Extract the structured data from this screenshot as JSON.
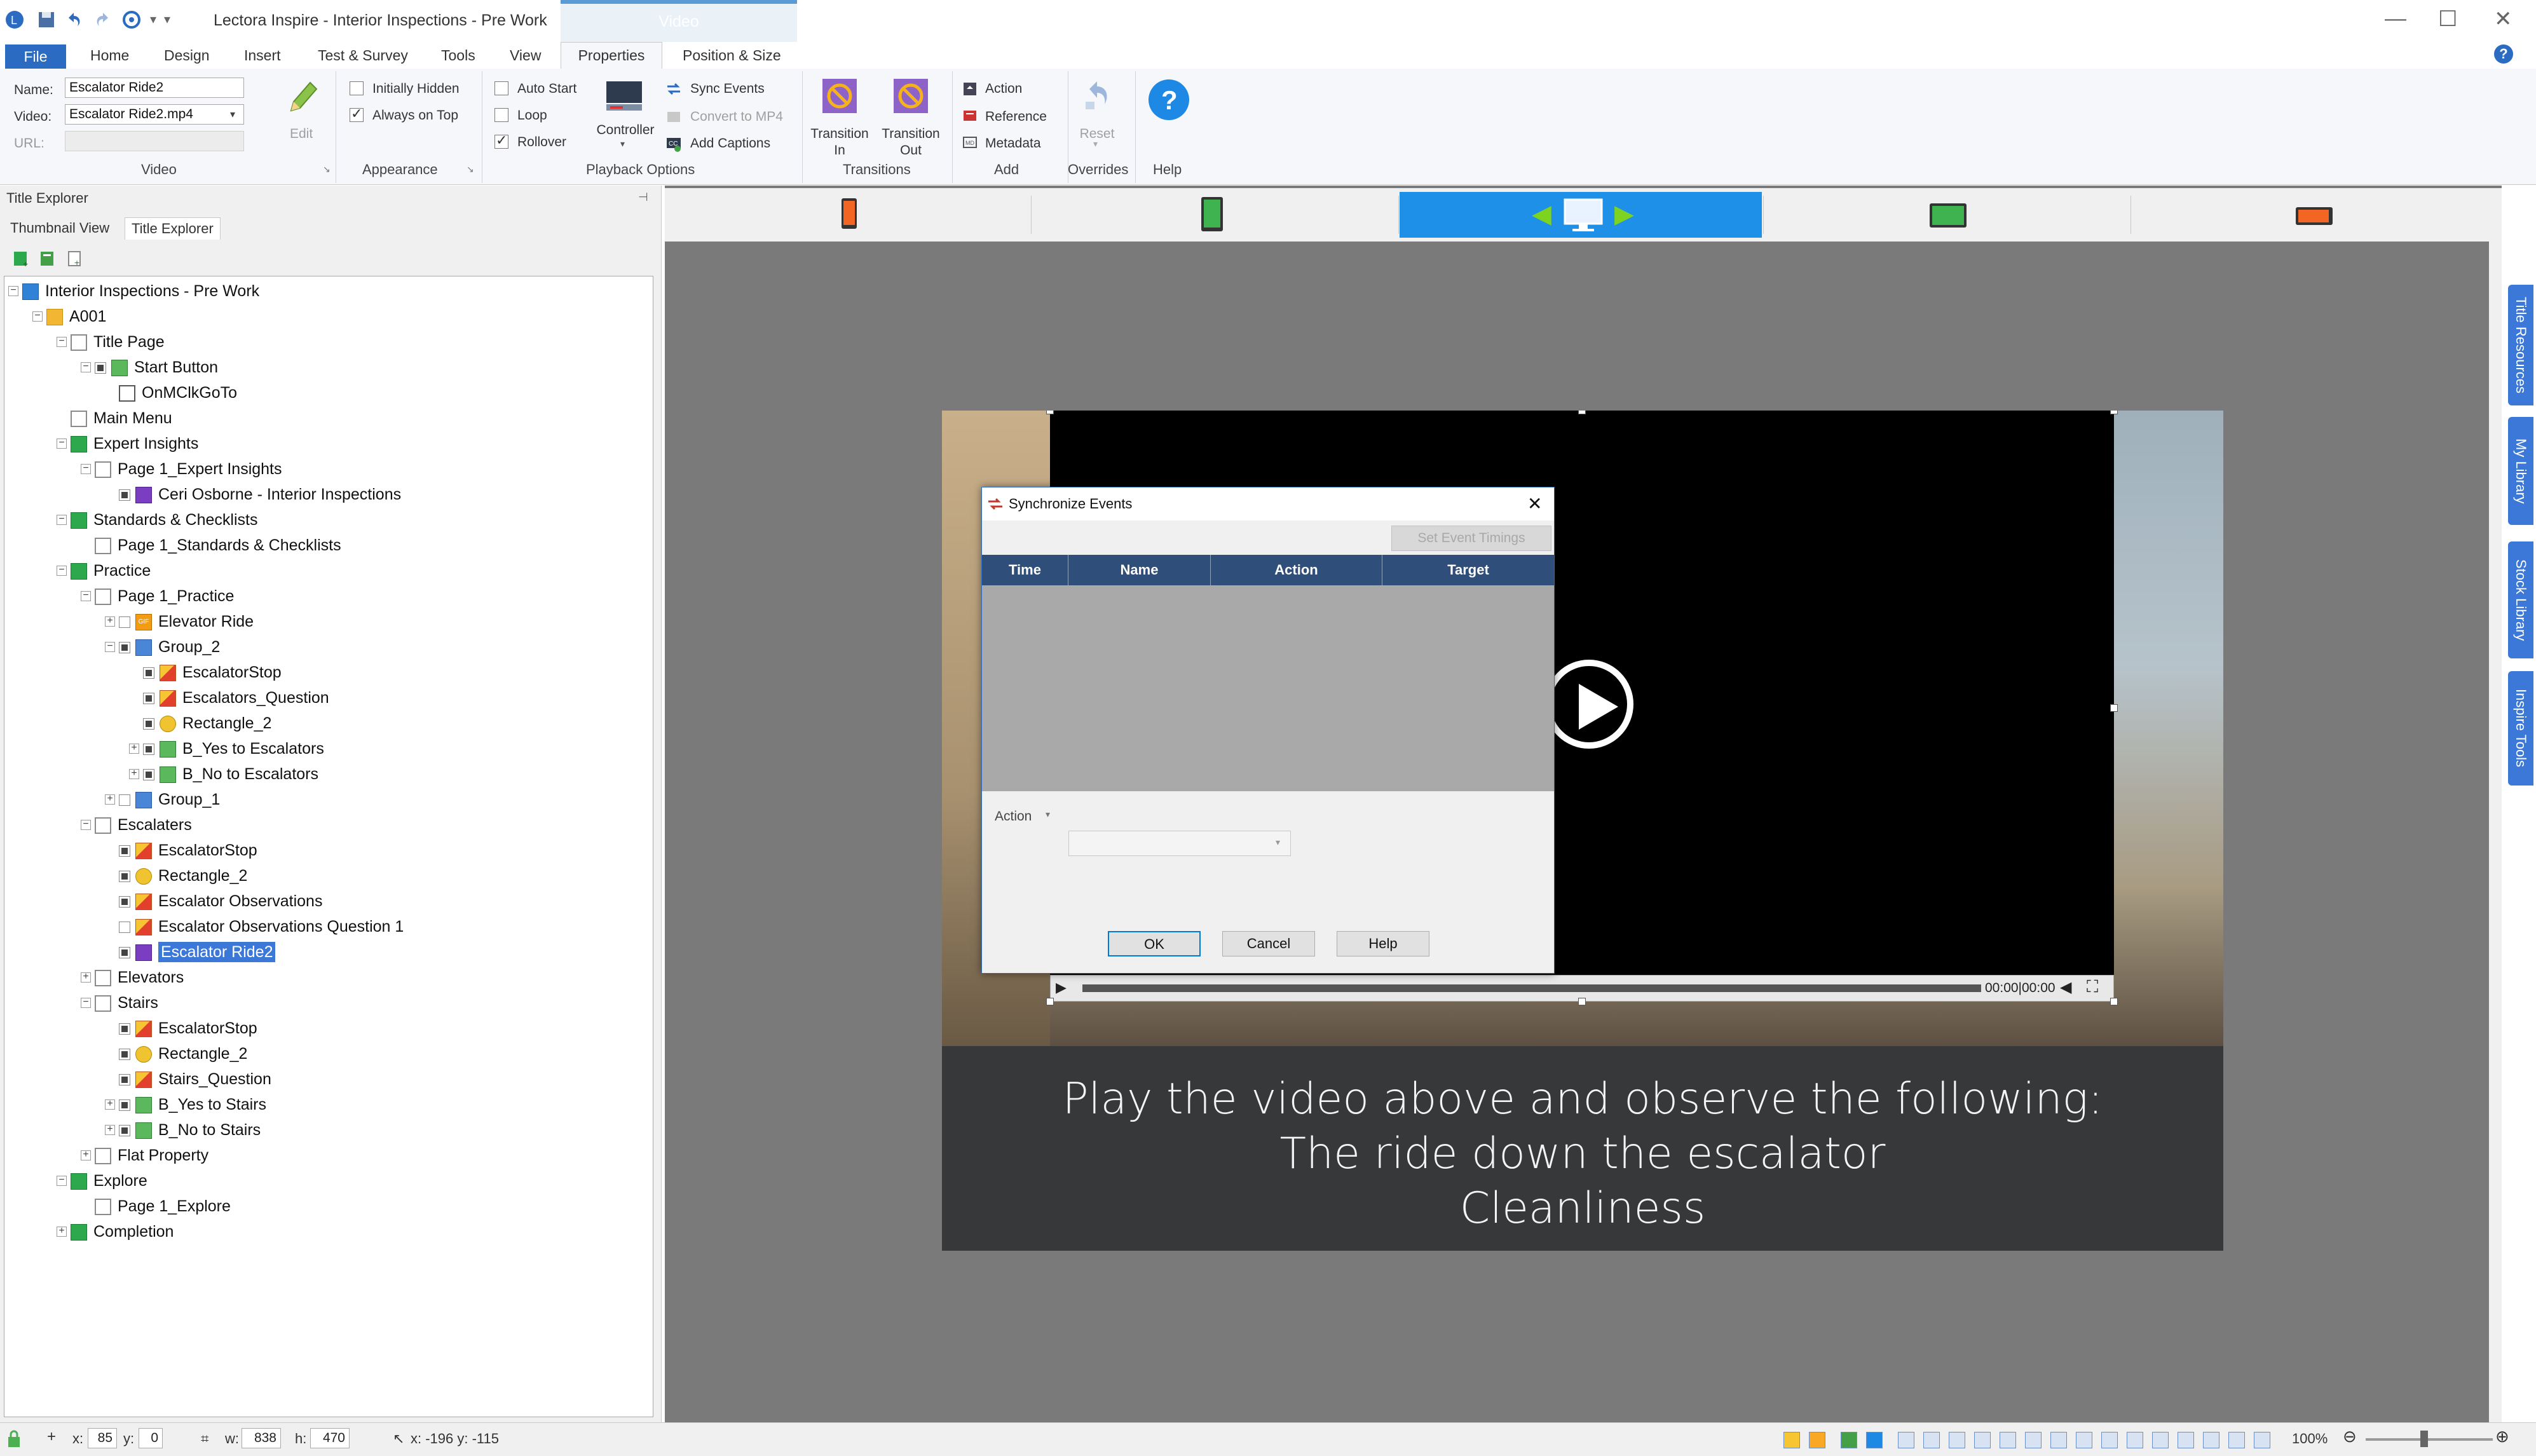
{
  "window": {
    "title": "Lectora Inspire - Interior Inspections - Pre Work",
    "context_tab_group": "Video"
  },
  "ribbon_tabs": [
    "File",
    "Home",
    "Design",
    "Insert",
    "Test & Survey",
    "Tools",
    "View",
    "Properties",
    "Position & Size"
  ],
  "ribbon": {
    "video_group": {
      "label": "Video",
      "name_label": "Name:",
      "name_value": "Escalator Ride2",
      "video_label": "Video:",
      "video_value": "Escalator Ride2.mp4",
      "url_label": "URL:"
    },
    "edit_label": "Edit",
    "appearance": {
      "label": "Appearance",
      "initially_hidden": "Initially Hidden",
      "always_on_top": "Always on Top"
    },
    "playback": {
      "label": "Playback Options",
      "auto_start": "Auto Start",
      "loop": "Loop",
      "rollover": "Rollover",
      "controller": "Controller",
      "sync_events": "Sync Events",
      "convert_mp4": "Convert to MP4",
      "add_captions": "Add Captions"
    },
    "transitions": {
      "label": "Transitions",
      "in_line1": "Transition",
      "in_line2": "In",
      "out_line1": "Transition",
      "out_line2": "Out"
    },
    "add": {
      "label": "Add",
      "action": "Action",
      "reference": "Reference",
      "metadata": "Metadata"
    },
    "overrides": {
      "label": "Overrides",
      "reset": "Reset"
    },
    "help": {
      "label": "Help"
    }
  },
  "left_panel": {
    "header": "Title Explorer",
    "tab_thumbnail": "Thumbnail View",
    "tab_title_explorer": "Title Explorer",
    "tree": [
      {
        "label": "Interior Inspections - Pre Work",
        "depth": 0,
        "icon": "title-icon",
        "expander": "-",
        "vis": "none"
      },
      {
        "label": "A001",
        "depth": 1,
        "icon": "folder-icon",
        "expander": "-",
        "vis": "none"
      },
      {
        "label": "Title Page",
        "depth": 2,
        "icon": "page-icon",
        "expander": "-",
        "vis": "none"
      },
      {
        "label": "Start Button",
        "depth": 3,
        "icon": "button-icon",
        "expander": "-",
        "vis": "on"
      },
      {
        "label": "OnMClkGoTo",
        "depth": 4,
        "icon": "action-icon",
        "expander": "",
        "vis": "none"
      },
      {
        "label": "Main Menu",
        "depth": 2,
        "icon": "page-icon",
        "expander": "",
        "vis": "none"
      },
      {
        "label": "Expert Insights",
        "depth": 2,
        "icon": "chapter-icon",
        "expander": "-",
        "vis": "none"
      },
      {
        "label": "Page 1_Expert Insights",
        "depth": 3,
        "icon": "page-icon",
        "expander": "-",
        "vis": "none"
      },
      {
        "label": "Ceri Osborne - Interior Inspections",
        "depth": 4,
        "icon": "video-icon",
        "expander": "",
        "vis": "on"
      },
      {
        "label": "Standards & Checklists",
        "depth": 2,
        "icon": "chapter-icon",
        "expander": "-",
        "vis": "none"
      },
      {
        "label": "Page 1_Standards & Checklists",
        "depth": 3,
        "icon": "page-icon",
        "expander": "",
        "vis": "none"
      },
      {
        "label": "Practice",
        "depth": 2,
        "icon": "chapter-icon",
        "expander": "-",
        "vis": "none"
      },
      {
        "label": "Page 1_Practice",
        "depth": 3,
        "icon": "page-icon",
        "expander": "-",
        "vis": "none"
      },
      {
        "label": "Elevator Ride",
        "depth": 4,
        "icon": "gif-icon",
        "expander": "+",
        "vis": "off"
      },
      {
        "label": "Group_2",
        "depth": 4,
        "icon": "group-icon",
        "expander": "-",
        "vis": "on"
      },
      {
        "label": "EscalatorStop",
        "depth": 5,
        "icon": "image-icon",
        "expander": "",
        "vis": "on"
      },
      {
        "label": "Escalators_Question",
        "depth": 5,
        "icon": "image-icon",
        "expander": "",
        "vis": "on"
      },
      {
        "label": "Rectangle_2",
        "depth": 5,
        "icon": "shape-icon",
        "expander": "",
        "vis": "on"
      },
      {
        "label": "B_Yes to Escalators",
        "depth": 5,
        "icon": "button-icon",
        "expander": "+",
        "vis": "on"
      },
      {
        "label": "B_No to Escalators",
        "depth": 5,
        "icon": "button-icon",
        "expander": "+",
        "vis": "on"
      },
      {
        "label": "Group_1",
        "depth": 4,
        "icon": "group-icon",
        "expander": "+",
        "vis": "off"
      },
      {
        "label": "Escalaters",
        "depth": 3,
        "icon": "page-icon",
        "expander": "-",
        "vis": "none"
      },
      {
        "label": "EscalatorStop",
        "depth": 4,
        "icon": "image-icon",
        "expander": "",
        "vis": "on"
      },
      {
        "label": "Rectangle_2",
        "depth": 4,
        "icon": "shape-icon",
        "expander": "",
        "vis": "on"
      },
      {
        "label": "Escalator Observations",
        "depth": 4,
        "icon": "image-icon",
        "expander": "",
        "vis": "on"
      },
      {
        "label": "Escalator Observations Question 1",
        "depth": 4,
        "icon": "image-icon",
        "expander": "",
        "vis": "off"
      },
      {
        "label": "Escalator Ride2",
        "depth": 4,
        "icon": "video-icon",
        "expander": "",
        "vis": "on",
        "selected": true
      },
      {
        "label": "Elevators",
        "depth": 3,
        "icon": "page-icon",
        "expander": "+",
        "vis": "none"
      },
      {
        "label": "Stairs",
        "depth": 3,
        "icon": "page-icon",
        "expander": "-",
        "vis": "none"
      },
      {
        "label": "EscalatorStop",
        "depth": 4,
        "icon": "image-icon",
        "expander": "",
        "vis": "on"
      },
      {
        "label": "Rectangle_2",
        "depth": 4,
        "icon": "shape-icon",
        "expander": "",
        "vis": "on"
      },
      {
        "label": "Stairs_Question",
        "depth": 4,
        "icon": "image-icon",
        "expander": "",
        "vis": "on"
      },
      {
        "label": "B_Yes to Stairs",
        "depth": 4,
        "icon": "button-icon",
        "expander": "+",
        "vis": "on"
      },
      {
        "label": "B_No to Stairs",
        "depth": 4,
        "icon": "button-icon",
        "expander": "+",
        "vis": "on"
      },
      {
        "label": "Flat Property",
        "depth": 3,
        "icon": "page-icon",
        "expander": "+",
        "vis": "none"
      },
      {
        "label": "Explore",
        "depth": 2,
        "icon": "chapter-icon",
        "expander": "-",
        "vis": "none"
      },
      {
        "label": "Page 1_Explore",
        "depth": 3,
        "icon": "page-icon",
        "expander": "",
        "vis": "none"
      },
      {
        "label": "Completion",
        "depth": 2,
        "icon": "chapter-icon",
        "expander": "+",
        "vis": "none"
      }
    ]
  },
  "stage": {
    "caption_lines": [
      "Play the video above and observe the following:",
      "The ride down the escalator",
      "Cleanliness"
    ],
    "video_time": "00:00|00:00"
  },
  "dialog": {
    "title": "Synchronize Events",
    "set_timings": "Set Event Timings",
    "columns": [
      "Time",
      "Name",
      "Action",
      "Target"
    ],
    "action_label": "Action",
    "ok": "OK",
    "cancel": "Cancel",
    "help": "Help"
  },
  "side_tabs": [
    "Title Resources",
    "My Library",
    "Stock Library",
    "Inspire Tools"
  ],
  "statusbar": {
    "x_label": "x:",
    "x_value": "85",
    "y_label": "y:",
    "y_value": "0",
    "w_label": "w:",
    "w_value": "838",
    "h_label": "h:",
    "h_value": "470",
    "cursor": "x: -196  y: -115",
    "zoom": "100%"
  },
  "colors": {
    "accent": "#2b6cc2",
    "selection": "#3b78d8",
    "dialog_header": "#2f4f7a"
  }
}
